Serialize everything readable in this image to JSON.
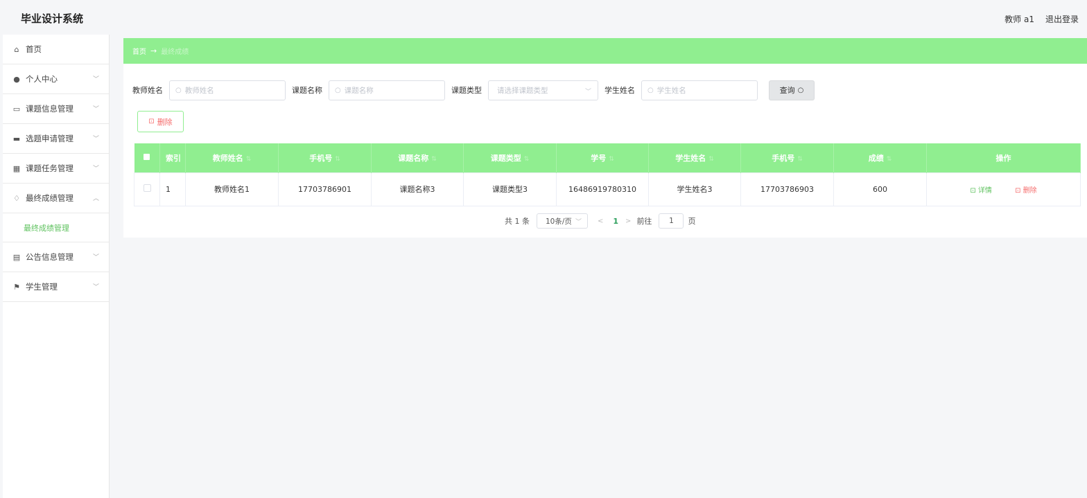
{
  "header": {
    "app_title": "毕业设计系统",
    "user": "教师 a1",
    "logout": "退出登录"
  },
  "sidebar": {
    "items": [
      {
        "label": "首页",
        "icon": "home-icon",
        "chevron": ""
      },
      {
        "label": "个人中心",
        "icon": "user-icon",
        "chevron": "﹀"
      },
      {
        "label": "课题信息管理",
        "icon": "document-icon",
        "chevron": "﹀"
      },
      {
        "label": "选题申请管理",
        "icon": "monitor-icon",
        "chevron": "﹀"
      },
      {
        "label": "课题任务管理",
        "icon": "grid-icon",
        "chevron": "﹀"
      },
      {
        "label": "最终成绩管理",
        "icon": "bell-icon",
        "chevron": "︿"
      },
      {
        "label": "最终成绩管理",
        "icon": "",
        "chevron": ""
      },
      {
        "label": "公告信息管理",
        "icon": "ticket-icon",
        "chevron": "﹀"
      },
      {
        "label": "学生管理",
        "icon": "flag-icon",
        "chevron": "﹀"
      }
    ]
  },
  "breadcrumb": {
    "home": "首页",
    "arrow": "→",
    "current": "最终成绩"
  },
  "filters": {
    "teacher_label": "教师姓名",
    "teacher_placeholder": "教师姓名",
    "topic_label": "课题名称",
    "topic_placeholder": "课题名称",
    "type_label": "课题类型",
    "type_placeholder": "请选择课题类型",
    "student_label": "学生姓名",
    "student_placeholder": "学生姓名",
    "query_label": "查询"
  },
  "actions": {
    "delete_label": "删除"
  },
  "table": {
    "columns": [
      "索引",
      "教师姓名",
      "手机号",
      "课题名称",
      "课题类型",
      "学号",
      "学生姓名",
      "手机号",
      "成绩",
      "操作"
    ],
    "rows": [
      {
        "index": "1",
        "teacher_name": "教师姓名1",
        "teacher_phone": "17703786901",
        "topic_name": "课题名称3",
        "topic_type": "课题类型3",
        "student_id": "16486919780310",
        "student_name": "学生姓名3",
        "student_phone": "17703786903",
        "score": "600",
        "detail_label": "详情",
        "delete_label": "删除"
      }
    ]
  },
  "pagination": {
    "total": "共 1 条",
    "page_size": "10条/页",
    "prev": "<",
    "current_page": "1",
    "next": ">",
    "goto_label": "前往",
    "goto_value": "1",
    "page_suffix": "页"
  },
  "colors": {
    "accent_green": "#90ee90",
    "danger": "#f56c6c",
    "link_green": "#5fc25f"
  }
}
